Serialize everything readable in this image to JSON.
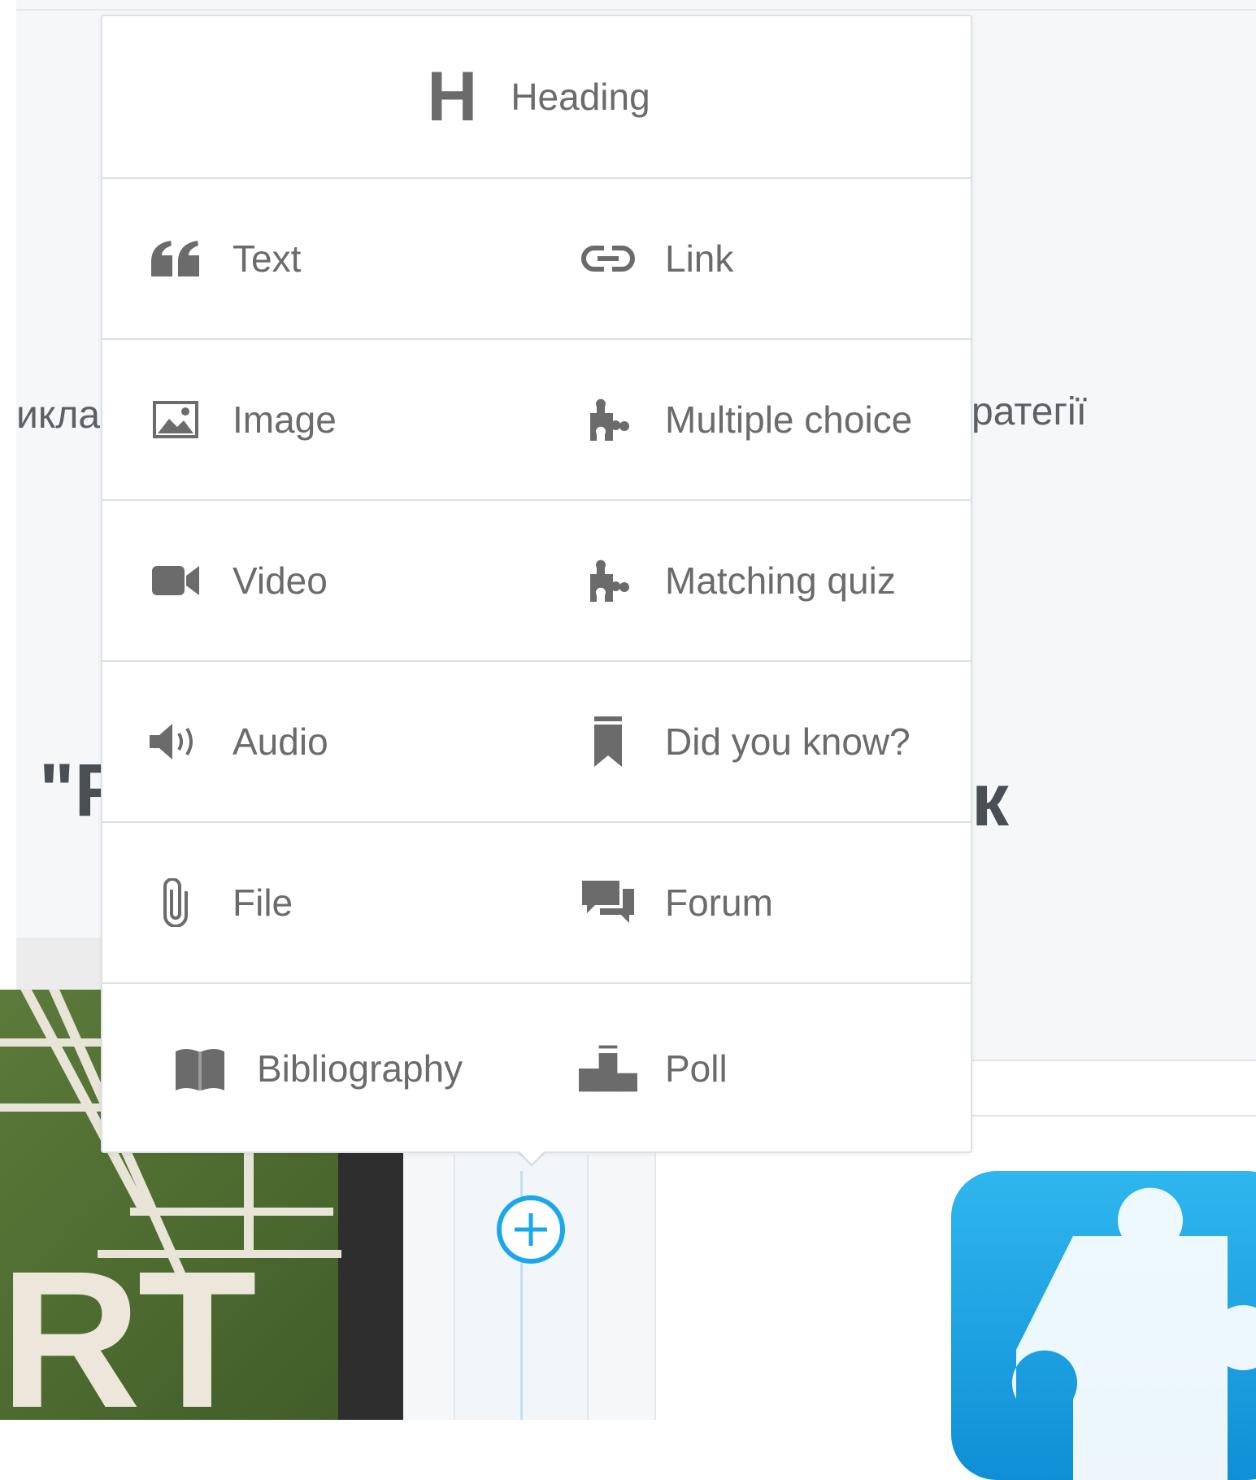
{
  "background": {
    "text_left": "икла",
    "text_right": "ратегії",
    "title_left": "\"F",
    "title_right": "к",
    "image_text": "RT"
  },
  "menu": {
    "heading": {
      "label": "Heading",
      "icon": "H"
    },
    "rows": [
      {
        "left": {
          "label": "Text",
          "icon": "quote-icon"
        },
        "right": {
          "label": "Link",
          "icon": "link-icon"
        }
      },
      {
        "left": {
          "label": "Image",
          "icon": "image-icon"
        },
        "right": {
          "label": "Multiple choice",
          "icon": "puzzle-icon"
        }
      },
      {
        "left": {
          "label": "Video",
          "icon": "video-camera-icon"
        },
        "right": {
          "label": "Matching quiz",
          "icon": "puzzle-icon"
        }
      },
      {
        "left": {
          "label": "Audio",
          "icon": "speaker-icon"
        },
        "right": {
          "label": "Did you know?",
          "icon": "bookmark-icon"
        }
      },
      {
        "left": {
          "label": "File",
          "icon": "paperclip-icon"
        },
        "right": {
          "label": "Forum",
          "icon": "chat-bubbles-icon"
        }
      },
      {
        "left": {
          "label": "Bibliography",
          "icon": "book-icon"
        },
        "right": {
          "label": "Poll",
          "icon": "podium-icon"
        }
      }
    ]
  },
  "colors": {
    "menu_text": "#6b6b6b",
    "accent": "#1aa7ec",
    "border": "#dde1e5",
    "page_bg": "#f5f7f9"
  }
}
